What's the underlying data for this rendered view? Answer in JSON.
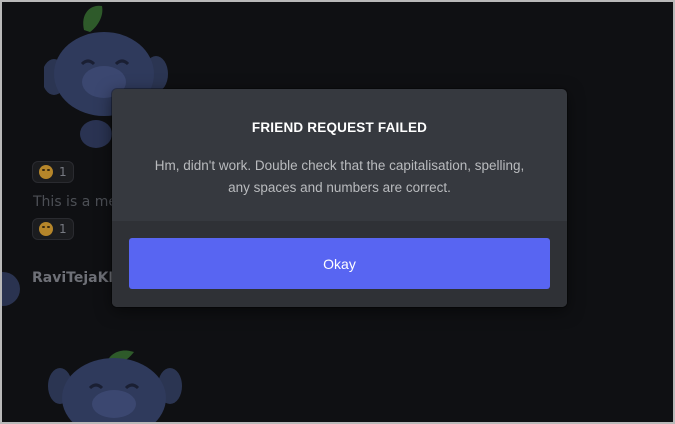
{
  "background": {
    "reactions": [
      {
        "emoji": "grinning-face",
        "count": "1"
      },
      {
        "emoji": "grinning-face",
        "count": "1"
      }
    ],
    "message_fragment": "This is a me",
    "username_fragment": "RaviTejaKN"
  },
  "dialog": {
    "title": "FRIEND REQUEST FAILED",
    "message": "Hm, didn't work. Double check that the capitalisation, spelling, any spaces and numbers are correct.",
    "okay_label": "Okay"
  },
  "colors": {
    "modal_bg": "#36393f",
    "footer_bg": "#2f3136",
    "button": "#5865f2",
    "title": "#ffffff",
    "message": "#b9bbbe"
  }
}
